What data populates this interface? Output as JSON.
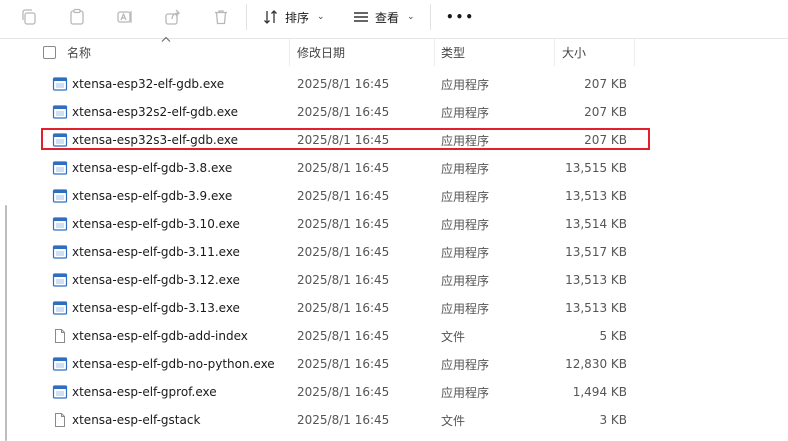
{
  "toolbar": {
    "sort_label": "排序",
    "view_label": "查看",
    "more_label": "•••",
    "icons": [
      "copy-icon",
      "paste-icon",
      "rename-icon",
      "share-icon",
      "delete-icon",
      "sort-icon",
      "view-icon",
      "more-icon"
    ]
  },
  "header": {
    "name": "名称",
    "date": "修改日期",
    "type": "类型",
    "size": "大小"
  },
  "files": [
    {
      "name": "xtensa-esp32-elf-gdb.exe",
      "date": "2025/8/1 16:45",
      "type": "应用程序",
      "size": "207 KB",
      "kind": "exe"
    },
    {
      "name": "xtensa-esp32s2-elf-gdb.exe",
      "date": "2025/8/1 16:45",
      "type": "应用程序",
      "size": "207 KB",
      "kind": "exe"
    },
    {
      "name": "xtensa-esp32s3-elf-gdb.exe",
      "date": "2025/8/1 16:45",
      "type": "应用程序",
      "size": "207 KB",
      "kind": "exe"
    },
    {
      "name": "xtensa-esp-elf-gdb-3.8.exe",
      "date": "2025/8/1 16:45",
      "type": "应用程序",
      "size": "13,515 KB",
      "kind": "exe"
    },
    {
      "name": "xtensa-esp-elf-gdb-3.9.exe",
      "date": "2025/8/1 16:45",
      "type": "应用程序",
      "size": "13,513 KB",
      "kind": "exe"
    },
    {
      "name": "xtensa-esp-elf-gdb-3.10.exe",
      "date": "2025/8/1 16:45",
      "type": "应用程序",
      "size": "13,514 KB",
      "kind": "exe"
    },
    {
      "name": "xtensa-esp-elf-gdb-3.11.exe",
      "date": "2025/8/1 16:45",
      "type": "应用程序",
      "size": "13,517 KB",
      "kind": "exe"
    },
    {
      "name": "xtensa-esp-elf-gdb-3.12.exe",
      "date": "2025/8/1 16:45",
      "type": "应用程序",
      "size": "13,513 KB",
      "kind": "exe"
    },
    {
      "name": "xtensa-esp-elf-gdb-3.13.exe",
      "date": "2025/8/1 16:45",
      "type": "应用程序",
      "size": "13,513 KB",
      "kind": "exe"
    },
    {
      "name": "xtensa-esp-elf-gdb-add-index",
      "date": "2025/8/1 16:45",
      "type": "文件",
      "size": "5 KB",
      "kind": "file"
    },
    {
      "name": "xtensa-esp-elf-gdb-no-python.exe",
      "date": "2025/8/1 16:45",
      "type": "应用程序",
      "size": "12,830 KB",
      "kind": "exe"
    },
    {
      "name": "xtensa-esp-elf-gprof.exe",
      "date": "2025/8/1 16:45",
      "type": "应用程序",
      "size": "1,494 KB",
      "kind": "exe"
    },
    {
      "name": "xtensa-esp-elf-gstack",
      "date": "2025/8/1 16:45",
      "type": "文件",
      "size": "3 KB",
      "kind": "file"
    }
  ],
  "highlighted_row": 2,
  "colors": {
    "highlight": "#e0202a",
    "exe_icon_blue": "#2f6fc2"
  }
}
